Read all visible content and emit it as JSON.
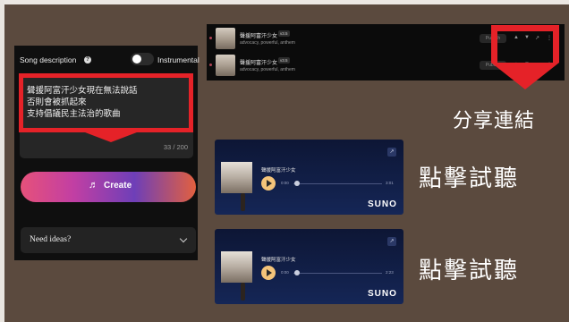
{
  "form": {
    "song_description_label": "Song description",
    "help_icon": "?",
    "instrumental_label": "Instrumental",
    "lyrics_lines": [
      "聲援阿富汗少女現在無法說話",
      "否則會被抓起來",
      "支持倡議民主法治的歌曲"
    ],
    "char_counter": "33 / 200",
    "create_icon": "♬",
    "create_label": "Create",
    "ideas_label": "Need ideas?",
    "instrumental_on": false
  },
  "song_list": [
    {
      "title": "聲援阿富汗少女",
      "version_badge": "v3.5",
      "tags": "advocacy, powerful, anthem",
      "publish_label": "Publish"
    },
    {
      "title": "聲援阿富汗少女",
      "version_badge": "v3.5",
      "tags": "advocacy, powerful, anthem",
      "publish_label": "Publish"
    }
  ],
  "annotations": {
    "share_link": "分享連結",
    "listen_1": "點擊試聽",
    "listen_2": "點擊試聽"
  },
  "players": [
    {
      "title": "聲援阿富汗少女",
      "current_time": "0:00",
      "duration": "3:01",
      "brand": "SUNO",
      "progress": 0
    },
    {
      "title": "聲援阿富汗少女",
      "current_time": "0:00",
      "duration": "2:23",
      "brand": "SUNO",
      "progress": 0
    }
  ],
  "colors": {
    "highlight": "#e52228",
    "background": "#5b4a3e",
    "player_bg": "#152656",
    "play_button": "#f4c47a"
  }
}
